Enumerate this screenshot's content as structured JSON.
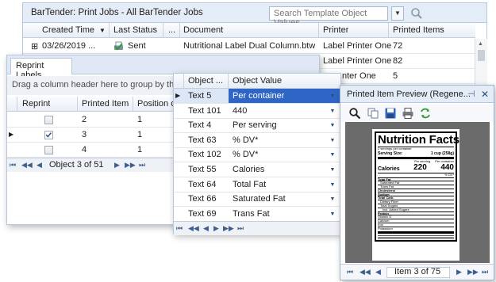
{
  "jobs_panel": {
    "title": "BarTender: Print Jobs - All BarTender Jobs",
    "search_placeholder": "Search Template Object Values",
    "columns": [
      "Created Time",
      "Last Status",
      "...",
      "Document",
      "Printer",
      "Printed Items"
    ],
    "rows": [
      {
        "expand": "⊞",
        "created": "03/26/2019 ...",
        "status": "Sent",
        "document": "Nutritional Label Dual Column.btw",
        "printer": "Label Printer One",
        "items": "72"
      },
      {
        "expand": "",
        "created": "",
        "status": "",
        "document": "btw",
        "printer": "Label Printer One",
        "items": "82"
      },
      {
        "expand": "",
        "created": "",
        "status": "",
        "document": "",
        "printer": "nter One",
        "items": "5"
      }
    ]
  },
  "reprint_panel": {
    "tab": "Reprint Labels",
    "group_hint": "Drag a column header here to group by that c",
    "columns": [
      "Reprint",
      "Printed Item",
      "Position o"
    ],
    "rows": [
      {
        "checked": false,
        "item": "2",
        "pos": "1"
      },
      {
        "checked": true,
        "item": "3",
        "pos": "1"
      },
      {
        "checked": false,
        "item": "4",
        "pos": "1"
      }
    ],
    "nav_text": "Object 3 of 51"
  },
  "values_panel": {
    "columns": [
      "Object ...",
      "Object Value"
    ],
    "rows": [
      {
        "object": "Text 5",
        "value": "Per container",
        "selected": true
      },
      {
        "object": "Text 101",
        "value": "440"
      },
      {
        "object": "Text 4",
        "value": "Per serving"
      },
      {
        "object": "Text 63",
        "value": "% DV*"
      },
      {
        "object": "Text 102",
        "value": "% DV*"
      },
      {
        "object": "Text 55",
        "value": "Calories"
      },
      {
        "object": "Text 64",
        "value": "Total Fat"
      },
      {
        "object": "Text 66",
        "value": "Saturated Fat"
      },
      {
        "object": "Text 69",
        "value": "Trans Fat"
      }
    ]
  },
  "preview_panel": {
    "title": "Printed Item Preview (Regene...",
    "pin": "⊣",
    "close": "✕",
    "nav_text": "Item 3 of 75",
    "label": {
      "heading": "Nutrition Facts",
      "servings": "2 servings per container",
      "serving_size_label": "Serving Size:",
      "serving_size_value": "1 cup (258g)",
      "per_serving": "Per serving",
      "per_container": "Per container",
      "calories_label": "Calories",
      "calories_serving": "220",
      "calories_container": "440",
      "dv": "% DV*",
      "nutrients": [
        "Total Fat",
        "Saturated Fat",
        "Trans Fat",
        "Cholesterol",
        "Sodium",
        "Total Carb.",
        "Dietary Fiber",
        "Total Sugars",
        "Incl. Added Sugars",
        "Protein",
        "Vitamin D",
        "Calcium",
        "Iron",
        "Potassium"
      ]
    }
  },
  "colors": {
    "accent": "#3d5e8e",
    "header_bg": "#e4ecf7",
    "selected_row": "#2f66c6",
    "border": "#b7c7dd"
  }
}
